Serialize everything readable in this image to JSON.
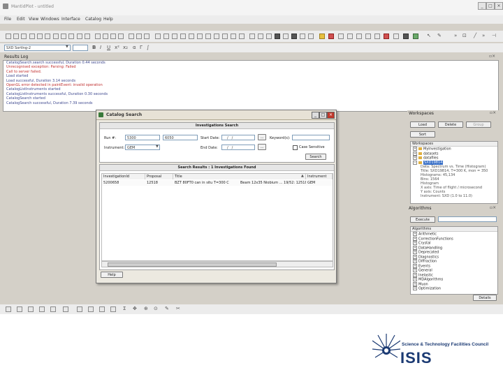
{
  "window": {
    "title": "MantidPlot - untitled",
    "min": "_",
    "max": "□",
    "close": "×"
  },
  "menu": [
    "File",
    "Edit",
    "View",
    "Windows",
    "Interface",
    "Catalog",
    "Help"
  ],
  "toolbar2": {
    "combo_value": "SXD SortIng-2"
  },
  "results_log": {
    "title": "Results Log",
    "lines": [
      {
        "text": "CatalogSearch.search successful, Duration 0.44 seconds",
        "color": "#404a90"
      },
      {
        "text": "Unrecognised exception: Parsing: Failed",
        "color": "#c03030"
      },
      {
        "text": "Call to server failed.",
        "color": "#c03030"
      },
      {
        "text": "Load started",
        "color": "#404a90"
      },
      {
        "text": "Load successful, Duration 3.14 seconds",
        "color": "#404a90"
      },
      {
        "text": "OpenGL error detected in paintEvent: invalid operation",
        "color": "#c03030"
      },
      {
        "text": "CatalogListInstruments started",
        "color": "#404a90"
      },
      {
        "text": "CatalogListInstruments successful, Duration 0.30 seconds",
        "color": "#404a90"
      },
      {
        "text": "CatalogSearch started",
        "color": "#404a90"
      },
      {
        "text": "CatalogSearch successful, Duration 7.39 seconds",
        "color": "#404a90"
      }
    ]
  },
  "dialog": {
    "title": "Catalog Search",
    "search_section_title": "Investigations Search",
    "run_label": "Run #:",
    "run_from": "5300",
    "run_to": "6050",
    "start_date_label": "Start Date:",
    "start_date_value": "__/__/____",
    "end_date_label": "End Date:",
    "end_date_value": "__/__/____",
    "date_btn": "...",
    "keywords_label": "Keyword(s):",
    "keywords_value": "",
    "instrument_label": "Instrument:",
    "instrument_value": "GEM",
    "case_sensitive_label": "Case Sensitive",
    "search_button": "Search",
    "results_section_title": "Search Results : 1 Investigations Found",
    "columns": [
      "InvestigationId",
      "Proposal",
      "Title",
      "Instrument"
    ],
    "rows": [
      {
        "id": "5200658",
        "proposal": "12518",
        "title": "BZT 80FT0 can in situ T=300 C",
        "extra": "Beam 12x35 Niobium ... 19/52: 12518",
        "instrument": "GEM"
      }
    ],
    "help_button": "Help"
  },
  "workspaces": {
    "title": "Workspaces",
    "load_button": "Load",
    "delete_button": "Delete",
    "group_button": "Group",
    "sort_button": "Sort",
    "tree_title": "Workspaces",
    "items": [
      {
        "label": "MyInvestigation",
        "kind": "group"
      },
      {
        "label": "datasets",
        "kind": "group"
      },
      {
        "label": "datafiles",
        "kind": "group"
      },
      {
        "label": "SXD19814",
        "kind": "selected"
      },
      {
        "label": "Data: Spectrum vs. Time (Histogram)",
        "kind": "sub"
      },
      {
        "label": "Title: SXD19814, T=300 K, mon = 350",
        "kind": "sub"
      },
      {
        "label": "Histograms: 45,134",
        "kind": "sub"
      },
      {
        "label": "Bins: 1564",
        "kind": "sub"
      },
      {
        "label": "Histogram",
        "kind": "sub"
      },
      {
        "label": "X axis: Time of flight / microsecond",
        "kind": "sub"
      },
      {
        "label": "Y axis: Counts",
        "kind": "sub"
      },
      {
        "label": "Instrument: SXD (1.0 to 11.0)",
        "kind": "sub"
      }
    ]
  },
  "algorithms": {
    "title": "Algorithms",
    "execute_button": "Execute",
    "search_value": "",
    "tree_title": "Algorithms",
    "items": [
      "Arithmetic",
      "CorrectionFunctions",
      "Crystal",
      "DataHandling",
      "Deprecated",
      "Diagnostics",
      "Diffraction",
      "Events",
      "General",
      "Inelastic",
      "MDAlgorithms",
      "Muon",
      "Optimization"
    ],
    "details_button": "Details"
  },
  "brand": {
    "council": "Science & Technology Facilities Council",
    "name": "ISIS"
  },
  "colors": {
    "dialog_icon": "#3a7a3a",
    "close_red": "#c0392b",
    "brand_blue": "#1b3a73",
    "selected": "#316ac5"
  }
}
